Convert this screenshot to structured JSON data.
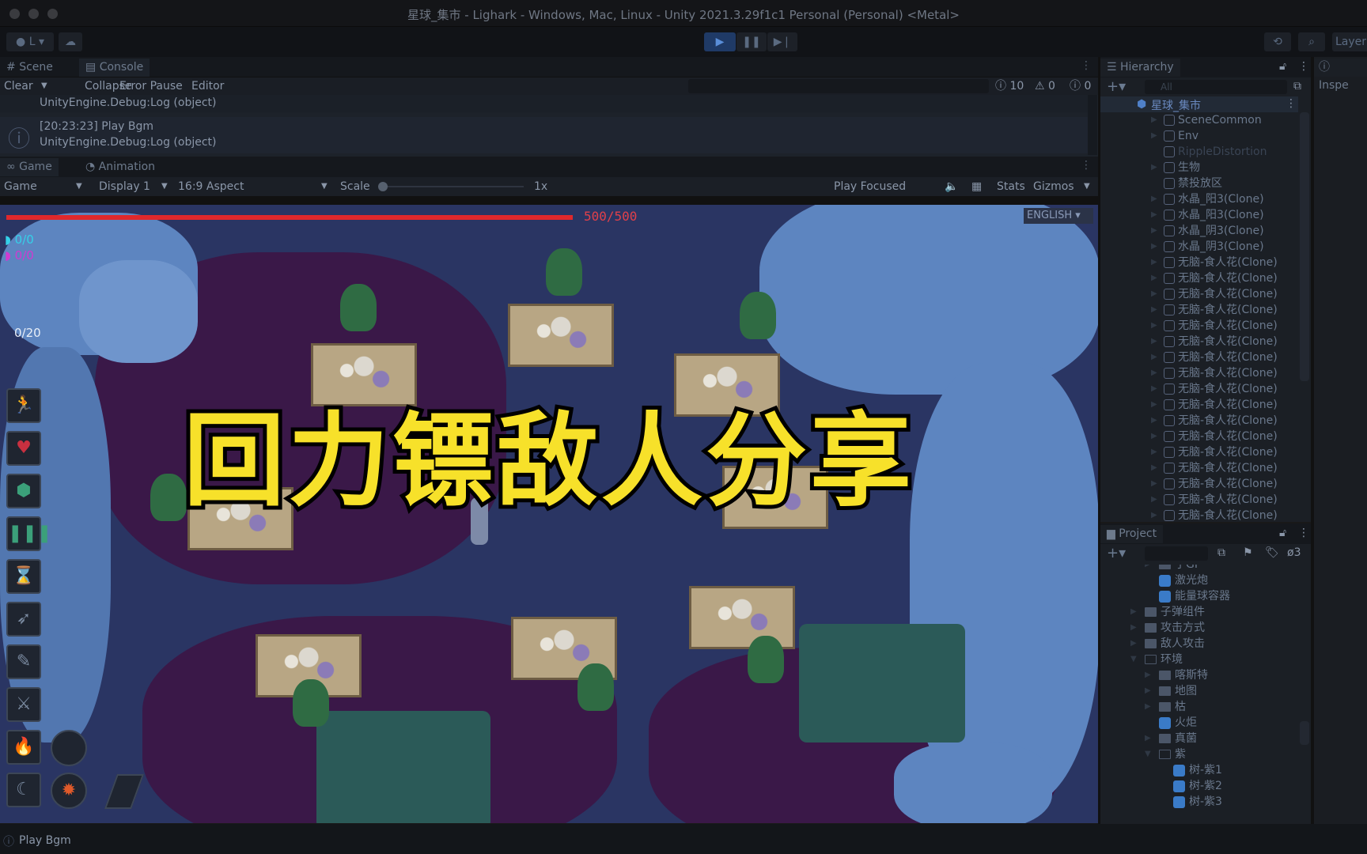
{
  "window": {
    "title": "星球_集市 - Lighark - Windows, Mac, Linux - Unity 2021.3.29f1c1 Personal (Personal) <Metal>"
  },
  "toolbar": {
    "account": "L",
    "layers": "Layer"
  },
  "console": {
    "tabs": [
      "Scene",
      "Console"
    ],
    "clear": "Clear",
    "collapse": "Collapse",
    "error_pause": "Error Pause",
    "editor": "Editor",
    "counts": {
      "info": "10",
      "warn": "0",
      "error": "0"
    },
    "entries": [
      {
        "line1": "UnityEngine.Debug:Log (object)"
      },
      {
        "line1": "[20:23:23] Play Bgm",
        "line2": "UnityEngine.Debug:Log (object)"
      }
    ]
  },
  "game": {
    "tabs": [
      "Game",
      "Animation"
    ],
    "mode": "Game",
    "display": "Display 1",
    "aspect": "16:9 Aspect",
    "scale_label": "Scale",
    "scale_value": "1x",
    "play_focused": "Play Focused",
    "stats": "Stats",
    "gizmos": "Gizmos",
    "hud": {
      "health": "500/500",
      "health_fraction": 1.0,
      "counter1": "0/0",
      "counter2": "0/0",
      "ammo": "0/20",
      "language": "ENGLISH"
    },
    "overlay_title": "回力镖敌人分享"
  },
  "hierarchy": {
    "title": "Hierarchy",
    "search_placeholder": "All",
    "scene": "星球_集市",
    "items": [
      "SceneCommon",
      "Env",
      "RippleDistortion",
      "生物",
      "禁投放区",
      "水晶_阳3(Clone)",
      "水晶_阳3(Clone)",
      "水晶_阴3(Clone)",
      "水晶_阴3(Clone)",
      "无脑-食人花(Clone)",
      "无脑-食人花(Clone)",
      "无脑-食人花(Clone)",
      "无脑-食人花(Clone)",
      "无脑-食人花(Clone)",
      "无脑-食人花(Clone)",
      "无脑-食人花(Clone)",
      "无脑-食人花(Clone)",
      "无脑-食人花(Clone)",
      "无脑-食人花(Clone)",
      "无脑-食人花(Clone)",
      "无脑-食人花(Clone)",
      "无脑-食人花(Clone)",
      "无脑-食人花(Clone)",
      "无脑-食人花(Clone)",
      "无脑-食人花(Clone)",
      "无脑-食人花(Clone)"
    ]
  },
  "project": {
    "title": "Project",
    "hidden_count": "3",
    "items": [
      {
        "label": "子GI",
        "type": "folder",
        "depth": 2
      },
      {
        "label": "激光炮",
        "type": "prefab",
        "depth": 2
      },
      {
        "label": "能量球容器",
        "type": "prefab",
        "depth": 2
      },
      {
        "label": "子弹组件",
        "type": "folder",
        "depth": 1
      },
      {
        "label": "攻击方式",
        "type": "folder",
        "depth": 1
      },
      {
        "label": "敌人攻击",
        "type": "folder",
        "depth": 1
      },
      {
        "label": "环境",
        "type": "open-folder",
        "depth": 1
      },
      {
        "label": "喀斯特",
        "type": "folder",
        "depth": 2
      },
      {
        "label": "地图",
        "type": "folder",
        "depth": 2
      },
      {
        "label": "枯",
        "type": "folder",
        "depth": 2
      },
      {
        "label": "火炬",
        "type": "prefab",
        "depth": 2
      },
      {
        "label": "真菌",
        "type": "folder",
        "depth": 2
      },
      {
        "label": "紫",
        "type": "open-folder",
        "depth": 2
      },
      {
        "label": "树-紫1",
        "type": "prefab",
        "depth": 3
      },
      {
        "label": "树-紫2",
        "type": "prefab",
        "depth": 3
      },
      {
        "label": "树-紫3",
        "type": "prefab",
        "depth": 3
      }
    ]
  },
  "inspector": {
    "title": "Inspe"
  },
  "status": {
    "message": "Play Bgm"
  }
}
